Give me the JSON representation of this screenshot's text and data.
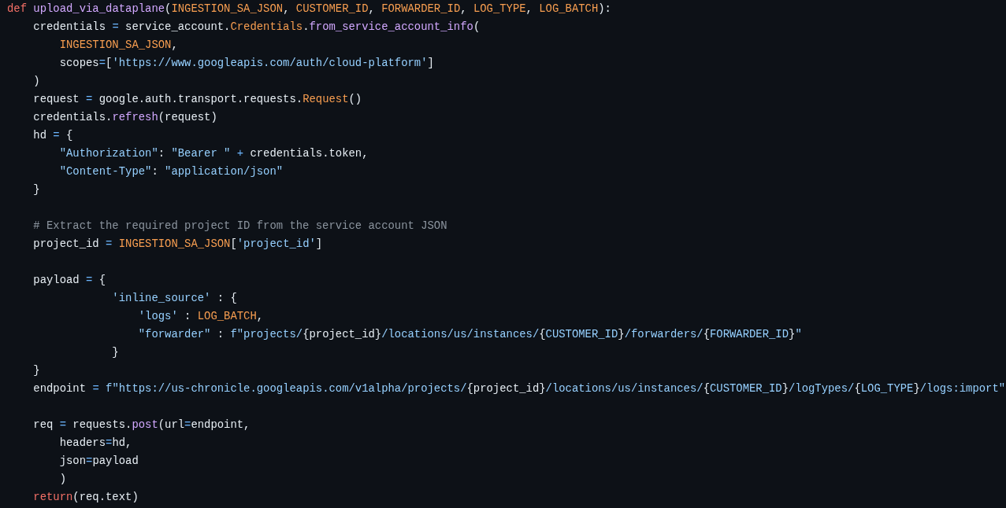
{
  "editor": {
    "lines": [
      {
        "tokens": [
          {
            "kind": "kw",
            "text": "def"
          },
          {
            "kind": "fn",
            "text": " upload_via_dataplane"
          },
          {
            "kind": "plain",
            "text": "("
          },
          {
            "kind": "const",
            "text": "INGESTION_SA_JSON"
          },
          {
            "kind": "plain",
            "text": ", "
          },
          {
            "kind": "const",
            "text": "CUSTOMER_ID"
          },
          {
            "kind": "plain",
            "text": ", "
          },
          {
            "kind": "const",
            "text": "FORWARDER_ID"
          },
          {
            "kind": "plain",
            "text": ", "
          },
          {
            "kind": "const",
            "text": "LOG_TYPE"
          },
          {
            "kind": "plain",
            "text": ", "
          },
          {
            "kind": "const",
            "text": "LOG_BATCH"
          },
          {
            "kind": "plain",
            "text": "):"
          }
        ]
      },
      {
        "tokens": [
          {
            "kind": "plain",
            "text": "    credentials "
          },
          {
            "kind": "op",
            "text": "="
          },
          {
            "kind": "plain",
            "text": " service_account."
          },
          {
            "kind": "cls",
            "text": "Credentials"
          },
          {
            "kind": "plain",
            "text": "."
          },
          {
            "kind": "method",
            "text": "from_service_account_info"
          },
          {
            "kind": "plain",
            "text": "("
          }
        ]
      },
      {
        "tokens": [
          {
            "kind": "const",
            "text": "        INGESTION_SA_JSON"
          },
          {
            "kind": "plain",
            "text": ","
          }
        ]
      },
      {
        "tokens": [
          {
            "kind": "plain",
            "text": "        scopes"
          },
          {
            "kind": "op",
            "text": "="
          },
          {
            "kind": "plain",
            "text": "["
          },
          {
            "kind": "str",
            "text": "'https://www.googleapis.com/auth/cloud-platform'"
          },
          {
            "kind": "plain",
            "text": "]"
          }
        ]
      },
      {
        "tokens": [
          {
            "kind": "plain",
            "text": "    )"
          }
        ]
      },
      {
        "tokens": [
          {
            "kind": "plain",
            "text": "    request "
          },
          {
            "kind": "op",
            "text": "="
          },
          {
            "kind": "plain",
            "text": " google.auth.transport.requests."
          },
          {
            "kind": "cls",
            "text": "Request"
          },
          {
            "kind": "plain",
            "text": "()"
          }
        ]
      },
      {
        "tokens": [
          {
            "kind": "plain",
            "text": "    credentials."
          },
          {
            "kind": "method",
            "text": "refresh"
          },
          {
            "kind": "plain",
            "text": "(request)"
          }
        ]
      },
      {
        "tokens": [
          {
            "kind": "plain",
            "text": "    hd "
          },
          {
            "kind": "op",
            "text": "="
          },
          {
            "kind": "plain",
            "text": " {"
          }
        ]
      },
      {
        "tokens": [
          {
            "kind": "str",
            "text": "        \"Authorization\""
          },
          {
            "kind": "plain",
            "text": ": "
          },
          {
            "kind": "str",
            "text": "\"Bearer \""
          },
          {
            "kind": "op",
            "text": " + "
          },
          {
            "kind": "plain",
            "text": "credentials.token,"
          }
        ]
      },
      {
        "tokens": [
          {
            "kind": "str",
            "text": "        \"Content-Type\""
          },
          {
            "kind": "plain",
            "text": ": "
          },
          {
            "kind": "str",
            "text": "\"application/json\""
          }
        ]
      },
      {
        "tokens": [
          {
            "kind": "plain",
            "text": "    }"
          }
        ]
      },
      {
        "kind": "blank"
      },
      {
        "tokens": [
          {
            "kind": "comment",
            "text": "    # Extract the required project ID from the service account JSON"
          }
        ]
      },
      {
        "tokens": [
          {
            "kind": "plain",
            "text": "    project_id "
          },
          {
            "kind": "op",
            "text": "="
          },
          {
            "kind": "const",
            "text": " INGESTION_SA_JSON"
          },
          {
            "kind": "plain",
            "text": "["
          },
          {
            "kind": "str",
            "text": "'project_id'"
          },
          {
            "kind": "plain",
            "text": "]"
          }
        ]
      },
      {
        "kind": "blank"
      },
      {
        "tokens": [
          {
            "kind": "plain",
            "text": "    payload "
          },
          {
            "kind": "op",
            "text": "="
          },
          {
            "kind": "plain",
            "text": " {"
          }
        ]
      },
      {
        "tokens": [
          {
            "kind": "str",
            "text": "                'inline_source'"
          },
          {
            "kind": "plain",
            "text": " : {"
          }
        ]
      },
      {
        "tokens": [
          {
            "kind": "str",
            "text": "                    'logs'"
          },
          {
            "kind": "plain",
            "text": " : "
          },
          {
            "kind": "const",
            "text": "LOG_BATCH"
          },
          {
            "kind": "plain",
            "text": ","
          }
        ]
      },
      {
        "tokens": [
          {
            "kind": "str",
            "text": "                    \"forwarder\""
          },
          {
            "kind": "plain",
            "text": " : "
          },
          {
            "kind": "str",
            "text": "f\"projects/"
          },
          {
            "kind": "plain",
            "text": "{project_id}"
          },
          {
            "kind": "str",
            "text": "/locations/us/instances/"
          },
          {
            "kind": "plain",
            "text": "{"
          },
          {
            "kind": "str",
            "text": "CUSTOMER_ID"
          },
          {
            "kind": "plain",
            "text": "}"
          },
          {
            "kind": "str",
            "text": "/forwarders/"
          },
          {
            "kind": "plain",
            "text": "{"
          },
          {
            "kind": "str",
            "text": "FORWARDER_ID"
          },
          {
            "kind": "plain",
            "text": "}"
          },
          {
            "kind": "str",
            "text": "\""
          }
        ]
      },
      {
        "tokens": [
          {
            "kind": "plain",
            "text": "                }"
          }
        ]
      },
      {
        "tokens": [
          {
            "kind": "plain",
            "text": "    }"
          }
        ]
      },
      {
        "tokens": [
          {
            "kind": "plain",
            "text": "    endpoint "
          },
          {
            "kind": "op",
            "text": "="
          },
          {
            "kind": "str",
            "text": " f\"https://us-chronicle.googleapis.com/v1alpha/projects/"
          },
          {
            "kind": "plain",
            "text": "{project_id}"
          },
          {
            "kind": "str",
            "text": "/locations/us/instances/"
          },
          {
            "kind": "plain",
            "text": "{"
          },
          {
            "kind": "str",
            "text": "CUSTOMER_ID"
          },
          {
            "kind": "plain",
            "text": "}"
          },
          {
            "kind": "str",
            "text": "/logTypes/"
          },
          {
            "kind": "plain",
            "text": "{"
          },
          {
            "kind": "str",
            "text": "LOG_TYPE"
          },
          {
            "kind": "plain",
            "text": "}"
          },
          {
            "kind": "str",
            "text": "/logs:import\""
          }
        ]
      },
      {
        "kind": "blank"
      },
      {
        "tokens": [
          {
            "kind": "plain",
            "text": "    req "
          },
          {
            "kind": "op",
            "text": "="
          },
          {
            "kind": "plain",
            "text": " requests."
          },
          {
            "kind": "method",
            "text": "post"
          },
          {
            "kind": "plain",
            "text": "(url"
          },
          {
            "kind": "op",
            "text": "="
          },
          {
            "kind": "plain",
            "text": "endpoint,"
          }
        ]
      },
      {
        "tokens": [
          {
            "kind": "plain",
            "text": "        headers"
          },
          {
            "kind": "op",
            "text": "="
          },
          {
            "kind": "plain",
            "text": "hd,"
          }
        ]
      },
      {
        "tokens": [
          {
            "kind": "plain",
            "text": "        json"
          },
          {
            "kind": "op",
            "text": "="
          },
          {
            "kind": "plain",
            "text": "payload"
          }
        ]
      },
      {
        "tokens": [
          {
            "kind": "plain",
            "text": "        )"
          }
        ]
      },
      {
        "tokens": [
          {
            "kind": "kw",
            "text": "    return"
          },
          {
            "kind": "plain",
            "text": "(req.text)"
          }
        ]
      }
    ]
  }
}
